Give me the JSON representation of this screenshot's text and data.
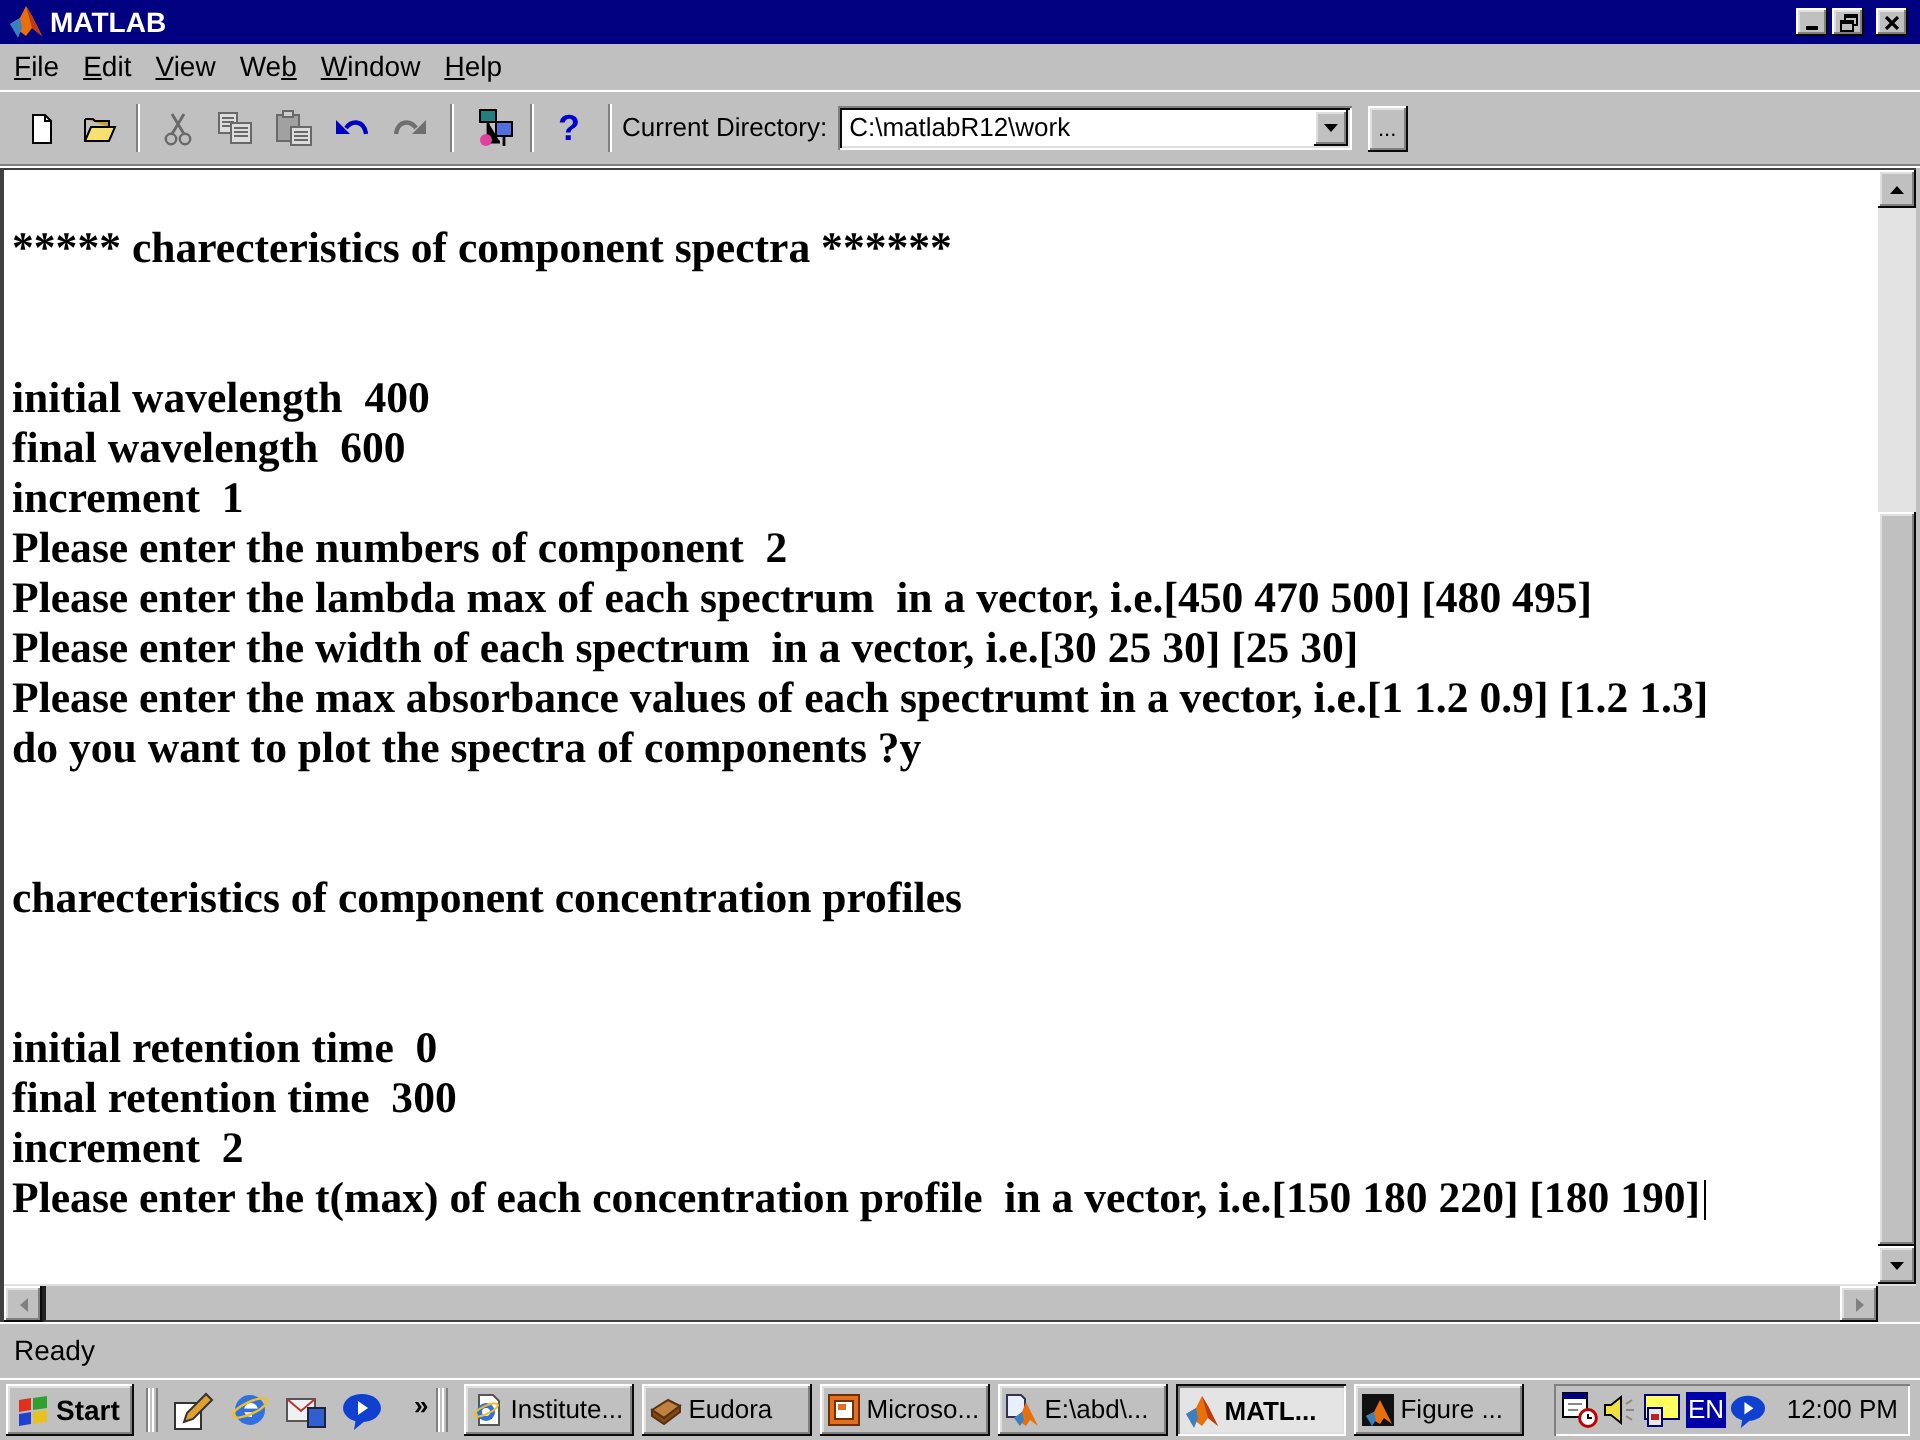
{
  "window": {
    "title": "MATLAB"
  },
  "menu": [
    {
      "label": "File",
      "mnemonic_last": false
    },
    {
      "label": "Edit",
      "mnemonic_last": false
    },
    {
      "label": "View",
      "mnemonic_last": false
    },
    {
      "label": "Web",
      "mnemonic_last": true
    },
    {
      "label": "Window",
      "mnemonic_last": false
    },
    {
      "label": "Help",
      "mnemonic_last": false
    }
  ],
  "toolbar": {
    "buttons": [
      {
        "disabled": false
      },
      {
        "disabled": false
      },
      {
        "disabled": true
      },
      {
        "disabled": true
      },
      {
        "disabled": true
      },
      {
        "disabled": false
      },
      {
        "disabled": true
      },
      {
        "disabled": false
      },
      {
        "label": "?",
        "disabled": false
      }
    ],
    "directory_label": "Current Directory:",
    "directory": {
      "value": "C:\\matlabR12\\work"
    },
    "browse_button": "..."
  },
  "command_window": {
    "blocks": [
      [
        "***** charecteristics of component spectra ******"
      ],
      [
        "initial wavelength  400",
        "final wavelength  600",
        "increment  1",
        "Please enter the numbers of component  2",
        "Please enter the lambda max of each spectrum  in a vector, i.e.[450 470 500] [480 495]",
        "Please enter the width of each spectrum  in a vector, i.e.[30 25 30] [25 30]",
        "Please enter the max absorbance values of each spectrumt in a vector, i.e.[1 1.2 0.9] [1.2 1.3]",
        "do you want to plot the spectra of components ?y"
      ],
      [
        "charecteristics of component concentration profiles"
      ],
      [
        "initial retention time  0",
        "final retention time  300",
        "increment  2",
        "Please enter the t(max) of each concentration profile  in a vector, i.e.[150 180 220] [180 190]"
      ]
    ]
  },
  "status_bar": {
    "text": "Ready"
  },
  "taskbar": {
    "start_button": "Start",
    "quick_launch_more": "»",
    "tasks": [
      {
        "label": "Institute...",
        "selected": false
      },
      {
        "label": "Eudora",
        "selected": false
      },
      {
        "label": "Microso...",
        "selected": false
      },
      {
        "label": "E:\\abd\\...",
        "selected": false
      },
      {
        "label": "MATL...",
        "selected": true
      },
      {
        "label": "Figure ...",
        "selected": false
      }
    ],
    "tray": {
      "language": "EN",
      "clock": "12:00 PM"
    }
  }
}
